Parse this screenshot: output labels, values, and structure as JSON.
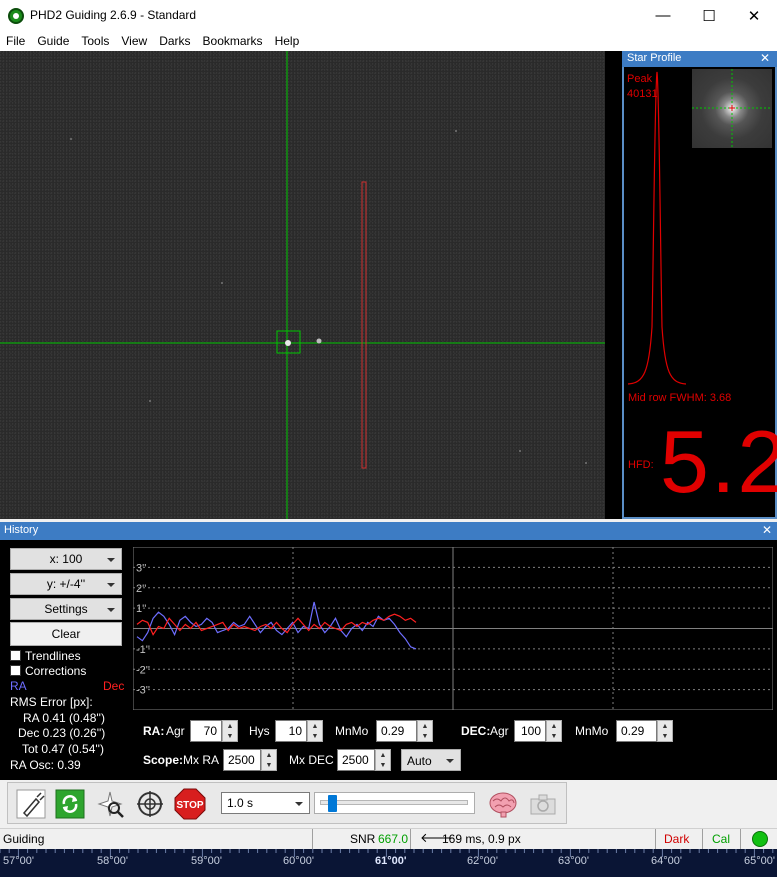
{
  "window": {
    "title": "PHD2 Guiding 2.6.9 - Standard",
    "controls": {
      "minimize": "—",
      "maximize": "☐",
      "close": "✕"
    }
  },
  "menu": [
    "File",
    "Guide",
    "Tools",
    "View",
    "Darks",
    "Bookmarks",
    "Help"
  ],
  "star_profile": {
    "title": "Star Profile",
    "close": "✕",
    "peak_label": "Peak",
    "peak_value": "40131",
    "fwhm_text": "Mid row FWHM: 3.68",
    "hfd_label": "HFD:",
    "hfd_value": "5.2"
  },
  "history": {
    "title": "History",
    "close": "✕",
    "x_scale": "x: 100",
    "y_scale": "y: +/-4''",
    "settings": "Settings",
    "clear": "Clear",
    "trendlines": "Trendlines",
    "corrections": "Corrections",
    "ra_label": "RA",
    "dec_label": "Dec",
    "rms_title": "RMS Error [px]:",
    "rms_ra": "RA 0.41 (0.48'')",
    "rms_dec": "Dec 0.23 (0.26'')",
    "rms_tot": "Tot 0.47 (0.54'')",
    "ra_osc": "RA Osc: 0.39",
    "y_ticks": [
      "3''",
      "2''",
      "1''",
      "-1''",
      "-2''",
      "-3''"
    ],
    "colors": {
      "ra": "#6e6eff",
      "dec": "#ff2020",
      "grid": "#808080"
    }
  },
  "chart_data": {
    "type": "line",
    "title": "",
    "ylim": [
      -4,
      4
    ],
    "series": [
      {
        "name": "RA",
        "values": [
          -0.4,
          -0.6,
          -0.2,
          0.5,
          0.8,
          0.6,
          0.2,
          -0.3,
          0.4,
          0.6,
          0.3,
          0.1,
          0.2,
          0.5,
          0.3,
          -0.2,
          -0.1,
          0.0,
          0.3,
          0.1,
          0.2,
          0.6,
          0.2,
          -0.2,
          0.1,
          0.3,
          -0.1,
          -0.3,
          0.0,
          0.3,
          -0.2,
          0.1,
          0.0,
          1.3,
          0.2,
          -0.2,
          0.1,
          0.5,
          -0.1,
          -0.4,
          0.0,
          0.2,
          -0.1,
          0.3,
          0.1,
          0.6,
          0.4,
          0.5,
          0.2,
          -0.2,
          -0.5,
          -0.9,
          -1.0
        ]
      },
      {
        "name": "Dec",
        "values": [
          0.2,
          0.4,
          0.3,
          -0.3,
          0.1,
          0.0,
          0.5,
          0.2,
          -0.1,
          0.2,
          0.0,
          0.3,
          -0.1,
          0.0,
          0.1,
          0.2,
          0.3,
          -0.1,
          0.2,
          0.0,
          0.1,
          0.0,
          -0.1,
          0.1,
          0.2,
          0.0,
          0.3,
          0.0,
          -0.2,
          0.2,
          0.5,
          0.2,
          -0.1,
          0.2,
          0.0,
          0.3,
          0.1,
          0.0,
          -0.1,
          0.2,
          0.3,
          0.1,
          0.3,
          0.2,
          0.4,
          0.5,
          0.4,
          0.6,
          0.7,
          0.6,
          0.4,
          0.5,
          0.3
        ]
      }
    ]
  },
  "controls": {
    "ra_label": "RA:",
    "ra_agr_label": "Agr",
    "ra_agr": "70",
    "ra_hys_label": "Hys",
    "ra_hys": "10",
    "ra_mnmo_label": "MnMo",
    "ra_mnmo": "0.29",
    "dec_label": "DEC:",
    "dec_agr_label": "Agr",
    "dec_agr": "100",
    "dec_mnmo_label": "MnMo",
    "dec_mnmo": "0.29",
    "scope_label": "Scope:",
    "mx_ra_label": "Mx RA",
    "mx_ra": "2500",
    "mx_dec_label": "Mx DEC",
    "mx_dec": "2500",
    "dec_mode": "Auto"
  },
  "toolbar": {
    "exposure": "1.0 s",
    "icons": [
      "usb-plug-icon",
      "loop-icon",
      "star-select-icon",
      "crosshair-icon",
      "stop-icon",
      "brain-icon",
      "camera-icon"
    ],
    "stop_label": "STOP"
  },
  "status": {
    "state": "Guiding",
    "snr_label": "SNR",
    "snr_value": "667.0",
    "guide_info": "169 ms, 0.9 px",
    "dark": "Dark",
    "cal": "Cal"
  },
  "ruler": {
    "labels": [
      "57°00'",
      "58°00'",
      "59°00'",
      "60°00'",
      "61°00'",
      "62°00'",
      "63°00'",
      "64°00'",
      "65°00'"
    ]
  }
}
